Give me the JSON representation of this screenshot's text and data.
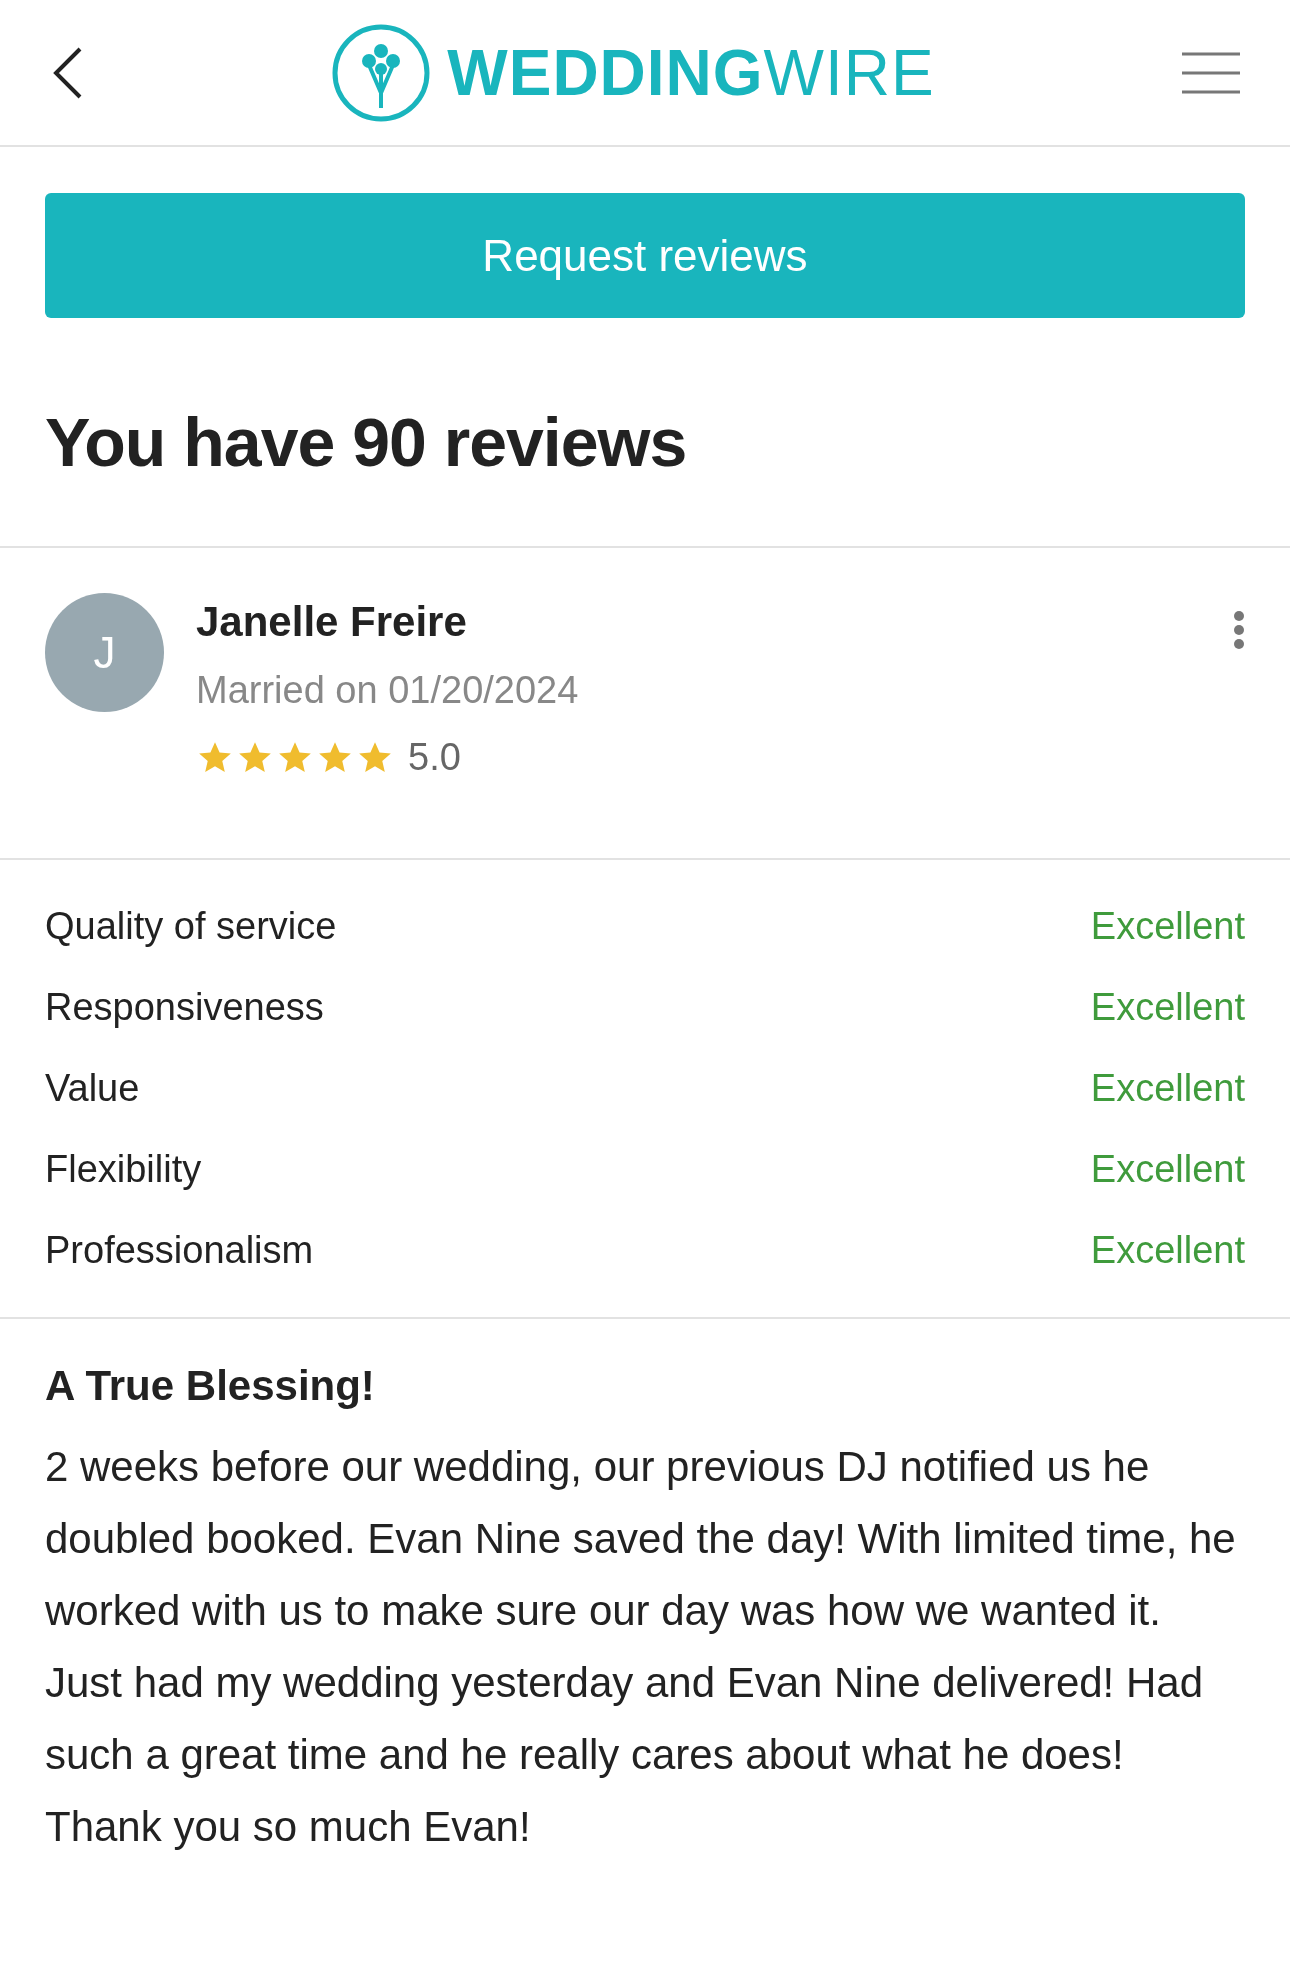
{
  "header": {
    "logo_text": "**WEDDING**WIRE"
  },
  "request_button": "Request reviews",
  "title": "You have 90 reviews",
  "review": {
    "avatar_initial": "J",
    "name": "Janelle Freire",
    "married": "Married on 01/20/2024",
    "stars": 5,
    "rating": "5.0",
    "ratings": [
      {
        "label": "Quality of service",
        "value": "Excellent"
      },
      {
        "label": "Responsiveness",
        "value": "Excellent"
      },
      {
        "label": "Value",
        "value": "Excellent"
      },
      {
        "label": "Flexibility",
        "value": "Excellent"
      },
      {
        "label": "Professionalism",
        "value": "Excellent"
      }
    ],
    "heading": "A True Blessing!",
    "body": "2 weeks before our wedding, our previous DJ notified us he doubled booked. Evan Nine saved the day! With limited time, he worked with us to make sure our day was how we wanted it. Just had my wedding yesterday and Evan Nine delivered! Had such a great time and he really cares about what he does! Thank you so much Evan!"
  }
}
